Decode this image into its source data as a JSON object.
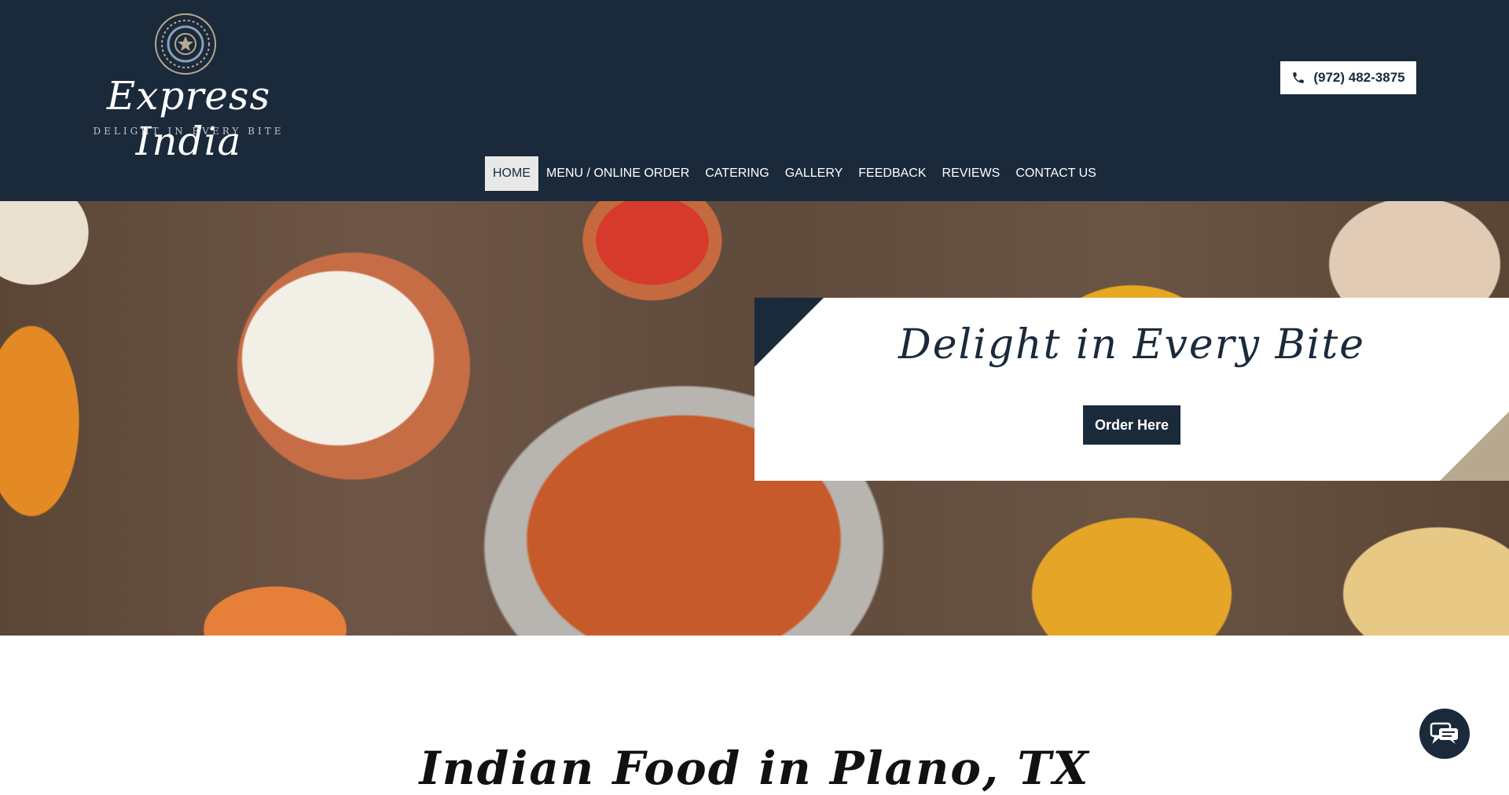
{
  "brand": {
    "name": "Express India",
    "tagline": "DELIGHT IN EVERY BITE",
    "logo_icon": "mandala-icon"
  },
  "header": {
    "phone": "(972) 482-3875",
    "phone_icon": "phone-icon"
  },
  "nav": {
    "items": [
      {
        "label": "HOME",
        "active": true
      },
      {
        "label": "MENU / ONLINE ORDER",
        "active": false
      },
      {
        "label": "CATERING",
        "active": false
      },
      {
        "label": "GALLERY",
        "active": false
      },
      {
        "label": "FEEDBACK",
        "active": false
      },
      {
        "label": "REVIEWS",
        "active": false
      },
      {
        "label": "CONTACT US",
        "active": false
      }
    ]
  },
  "hero": {
    "tagline": "Delight in Every Bite",
    "cta_label": "Order Here",
    "image_alt": "food-spread-image"
  },
  "section": {
    "title": "Indian Food in Plano, TX"
  },
  "chat": {
    "icon": "chat-icon"
  },
  "colors": {
    "primary": "#1a2a3b",
    "accent": "#b7a88f",
    "background": "#ffffff"
  }
}
